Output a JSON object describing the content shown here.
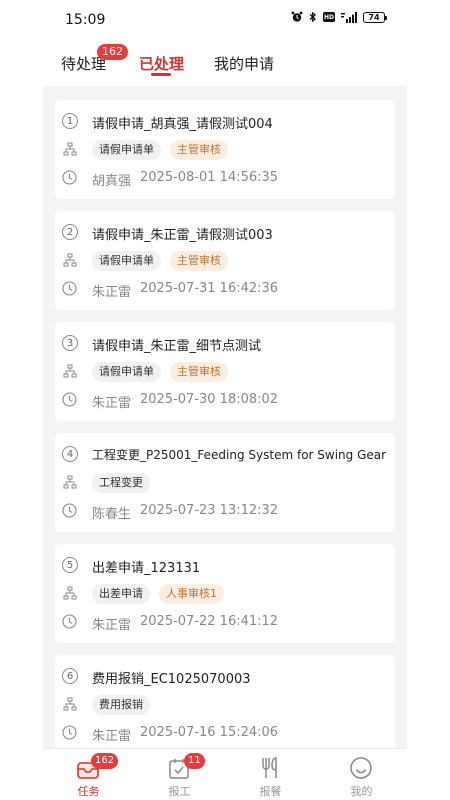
{
  "status_bar": {
    "time": "15:09",
    "battery": "74"
  },
  "tabs": [
    {
      "label": "待处理",
      "badge": "162"
    },
    {
      "label": "已处理",
      "active": true
    },
    {
      "label": "我的申请"
    }
  ],
  "items": [
    {
      "num": "1",
      "title": "请假申请_胡真强_请假测试004",
      "type": "请假申请单",
      "stage": "主管审核",
      "name": "胡真强",
      "time": "2025-08-01 14:56:35"
    },
    {
      "num": "2",
      "title": "请假申请_朱正雷_请假测试003",
      "type": "请假申请单",
      "stage": "主管审核",
      "name": "朱正雷",
      "time": "2025-07-31 16:42:36"
    },
    {
      "num": "3",
      "title": "请假申请_朱正雷_细节点测试",
      "type": "请假申请单",
      "stage": "主管审核",
      "name": "朱正雷",
      "time": "2025-07-30 18:08:02"
    },
    {
      "num": "4",
      "title": "工程变更_P25001_Feeding System for Swing Gear",
      "type": "工程变更",
      "stage": "",
      "name": "陈春生",
      "time": "2025-07-23 13:12:32"
    },
    {
      "num": "5",
      "title": "出差申请_123131",
      "type": "出差申请",
      "stage": "人事审核1",
      "name": "朱正雷",
      "time": "2025-07-22 16:41:12"
    },
    {
      "num": "6",
      "title": "费用报销_EC1025070003",
      "type": "费用报销",
      "stage": "",
      "name": "朱正雷",
      "time": "2025-07-16 15:24:06"
    }
  ],
  "bottom_nav": [
    {
      "label": "任务",
      "badge": "162",
      "icon": "task-icon",
      "active": true
    },
    {
      "label": "报工",
      "badge": "11",
      "icon": "report-icon"
    },
    {
      "label": "报餐",
      "icon": "fork-knife-icon"
    },
    {
      "label": "我的",
      "icon": "smiley-icon"
    }
  ],
  "colors": {
    "accent": "#d9322b",
    "badge": "#ea3b3b",
    "stage_tag_bg": "#fbeee0",
    "stage_tag_text": "#b8743a",
    "page_bg": "#f3f4f6"
  }
}
